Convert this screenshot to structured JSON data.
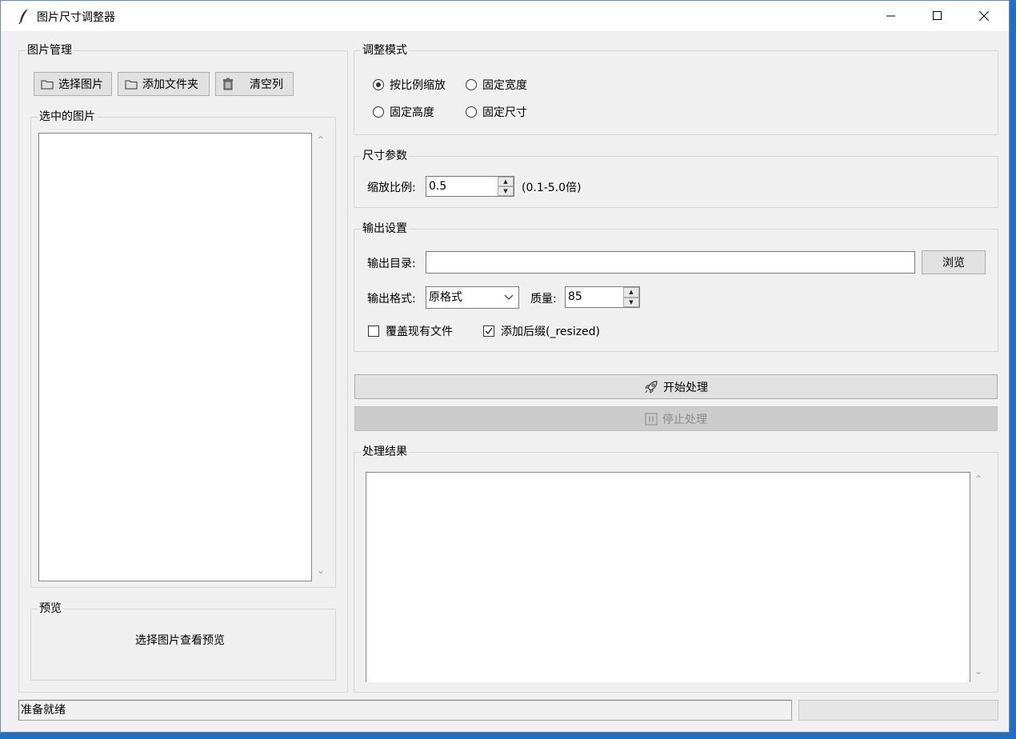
{
  "window": {
    "title": "图片尺寸调整器"
  },
  "image_mgmt": {
    "group_label": "图片管理",
    "buttons": {
      "select": "选择图片",
      "add_folder": "添加文件夹",
      "clear": "清空列"
    },
    "selected_label": "选中的图片",
    "items": []
  },
  "preview": {
    "group_label": "预览",
    "text": "选择图片查看预览"
  },
  "mode": {
    "group_label": "调整模式",
    "options": [
      {
        "label": "按比例缩放",
        "selected": true
      },
      {
        "label": "固定宽度",
        "selected": false
      },
      {
        "label": "固定高度",
        "selected": false
      },
      {
        "label": "固定尺寸",
        "selected": false
      }
    ]
  },
  "size_params": {
    "group_label": "尺寸参数",
    "scale_label": "缩放比例:",
    "scale_value": "0.5",
    "scale_range": "(0.1-5.0倍)"
  },
  "output": {
    "group_label": "输出设置",
    "dir_label": "输出目录:",
    "dir_value": "",
    "browse_label": "浏览",
    "format_label": "输出格式:",
    "format_value": "原格式",
    "quality_label": "质量:",
    "quality_value": "85",
    "overwrite_label": "覆盖现有文件",
    "overwrite_checked": false,
    "suffix_label": "添加后缀(_resized)",
    "suffix_checked": true
  },
  "actions": {
    "start_label": "开始处理",
    "stop_label": "停止处理"
  },
  "results": {
    "group_label": "处理结果",
    "text": ""
  },
  "status": {
    "text": "准备就绪",
    "progress": 0
  }
}
